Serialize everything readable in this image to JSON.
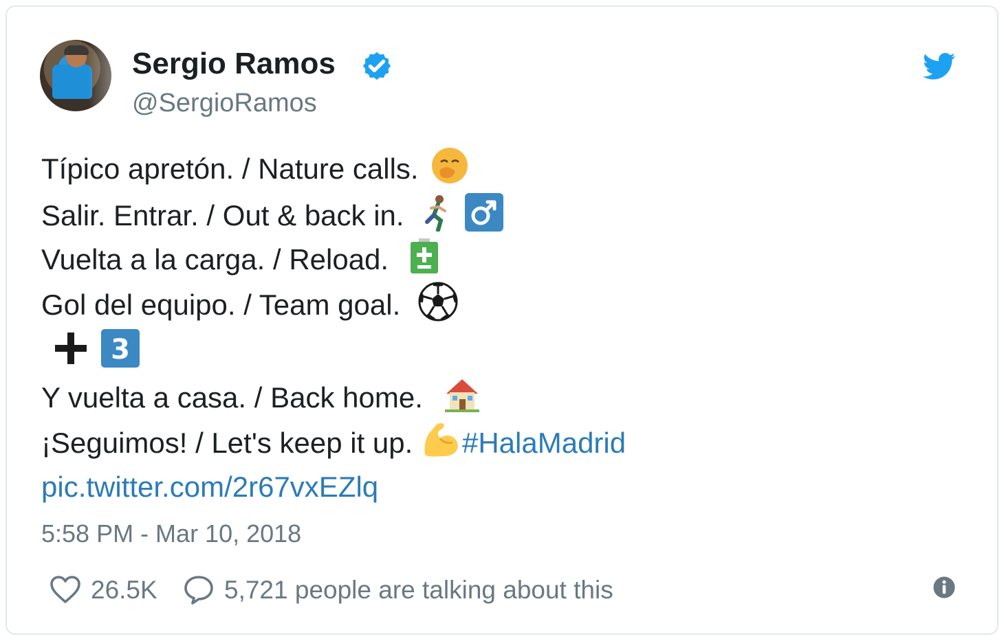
{
  "author": {
    "name": "Sergio Ramos",
    "handle": "@SergioRamos",
    "verified": true
  },
  "colors": {
    "link": "#2b7bb9",
    "twitter_blue": "#1da1f2",
    "secondary_text": "#697882",
    "primary_text": "#1c2022",
    "border": "#e1e8ed"
  },
  "tweet": {
    "lines": [
      {
        "text": "Típico apretón. / Nature calls.",
        "emoji": "face-with-hand-over-mouth"
      },
      {
        "text": "Salir. Entrar. / Out & back in.",
        "emoji": "man-running"
      },
      {
        "text": "Vuelta a la carga. / Reload.",
        "emoji": "battery-charge"
      },
      {
        "text": "Gol del equipo. / Team goal.",
        "emoji": "soccer-ball"
      },
      {
        "text": "",
        "emoji": "plus-three"
      },
      {
        "text": "Y vuelta a casa. / Back home.",
        "emoji": "house"
      },
      {
        "text": "¡Seguimos! / Let's keep it up.",
        "emoji": "flexed-biceps",
        "hashtag": "#HalaMadrid"
      },
      {
        "link": "pic.twitter.com/2r67vxEZlq"
      }
    ],
    "timestamp": "5:58 PM - Mar 10, 2018"
  },
  "footer": {
    "likes": "26.5K",
    "talking": "5,721 people are talking about this",
    "icons": [
      "heart-icon",
      "comment-bubble-icon",
      "info-icon"
    ]
  }
}
